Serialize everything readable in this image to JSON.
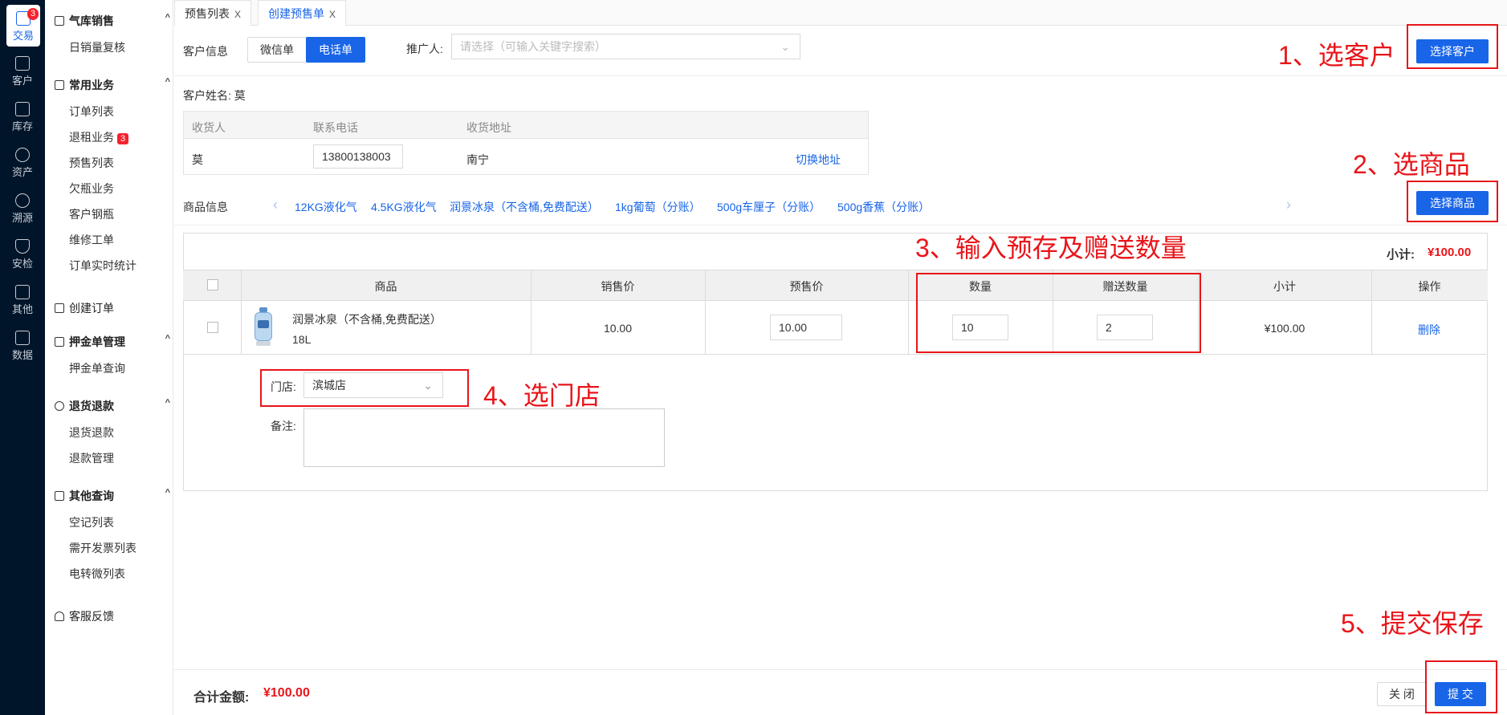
{
  "rail": {
    "items": [
      {
        "label": "交易",
        "icon": "bag-icon",
        "badge": "3"
      },
      {
        "label": "客户",
        "icon": "id-card-icon"
      },
      {
        "label": "库存",
        "icon": "list-icon"
      },
      {
        "label": "资产",
        "icon": "bulb-icon"
      },
      {
        "label": "溯源",
        "icon": "compass-icon"
      },
      {
        "label": "安检",
        "icon": "shield-icon"
      },
      {
        "label": "其他",
        "icon": "grid-icon"
      },
      {
        "label": "数据",
        "icon": "chart-icon"
      }
    ]
  },
  "menu": {
    "groups": [
      {
        "label": "气库销售",
        "items": [
          "日销量复核"
        ]
      },
      {
        "label": "常用业务",
        "items": [
          "订单列表",
          "退租业务",
          "预售列表",
          "欠瓶业务",
          "客户钢瓶",
          "维修工单",
          "订单实时统计"
        ],
        "badge": "3"
      },
      {
        "label": "创建订单"
      },
      {
        "label": "押金单管理",
        "items": [
          "押金单查询"
        ]
      },
      {
        "label": "退货退款",
        "items": [
          "退货退款",
          "退款管理"
        ]
      },
      {
        "label": "其他查询",
        "items": [
          "空记列表",
          "需开发票列表",
          "电转微列表"
        ]
      },
      {
        "label": "客服反馈"
      }
    ]
  },
  "tabs": [
    {
      "label": "预售列表",
      "close": "X"
    },
    {
      "label": "创建预售单",
      "close": "X"
    }
  ],
  "customer": {
    "label": "客户信息",
    "type_wechat": "微信单",
    "type_phone": "电话单",
    "promoter_label": "推广人:",
    "promoter_placeholder": "请选择（可输入关键字搜索）",
    "select_btn": "选择客户",
    "name_line": "客户姓名: 莫",
    "table_headers": [
      "收货人",
      "联系电话",
      "收货地址"
    ],
    "receiver": "莫",
    "phone": "13800138003",
    "address": "南宁",
    "switch_address": "切换地址"
  },
  "goods": {
    "label": "商品信息",
    "chips": [
      "12KG液化气",
      "4.5KG液化气",
      "润景冰泉（不含桶,免费配送）",
      "1kg葡萄（分账）",
      "500g车厘子（分账）",
      "500g香蕉（分账）"
    ],
    "select_btn": "选择商品",
    "subtotal_label": "小计:",
    "subtotal_value": "¥100.00",
    "headers": [
      "商品",
      "销售价",
      "预售价",
      "数量",
      "赠送数量",
      "小计",
      "操作"
    ],
    "row": {
      "name": "润景冰泉（不含桶,免费配送）",
      "spec": "18L",
      "sale_price": "10.00",
      "presale_price": "10.00",
      "quantity": "10",
      "gift_quantity": "2",
      "subtotal": "¥100.00",
      "action": "删除"
    },
    "store_label": "门店:",
    "store_value": "滨城店",
    "remark_label": "备注:"
  },
  "annotations": {
    "a1": "1、选客户",
    "a2": "2、选商品",
    "a3": "3、输入预存及赠送数量",
    "a4": "4、选门店",
    "a5": "5、提交保存"
  },
  "footer": {
    "total_label": "合计金额:",
    "total_value": "¥100.00",
    "close_btn": "关 闭",
    "submit_btn": "提 交"
  },
  "colors": {
    "primary": "#1865e8",
    "annotation": "#e8151a",
    "price": "#e8151a",
    "sidebar_bg": "#001529"
  }
}
